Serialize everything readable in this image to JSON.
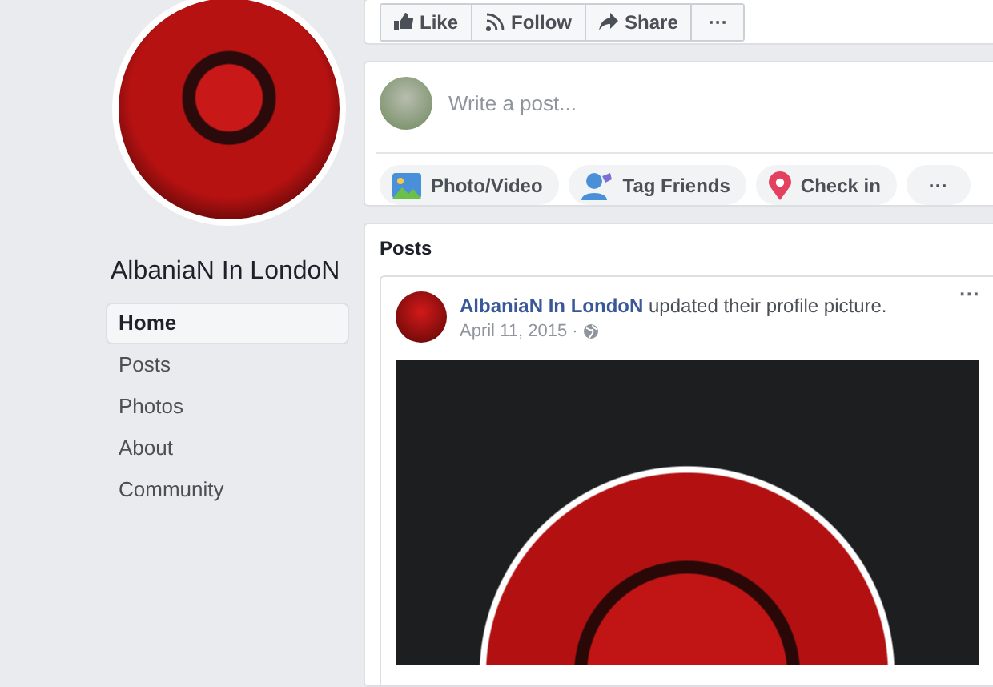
{
  "sidebar": {
    "page_name": "AlbaniaN In LondoN",
    "nav": [
      {
        "label": "Home",
        "selected": true
      },
      {
        "label": "Posts",
        "selected": false
      },
      {
        "label": "Photos",
        "selected": false
      },
      {
        "label": "About",
        "selected": false
      },
      {
        "label": "Community",
        "selected": false
      }
    ]
  },
  "page_actions": [
    {
      "kind": "like",
      "label": "Like"
    },
    {
      "kind": "follow",
      "label": "Follow"
    },
    {
      "kind": "share",
      "label": "Share"
    },
    {
      "kind": "more",
      "label": "···"
    }
  ],
  "composer": {
    "placeholder": "Write a post...",
    "actions": [
      {
        "kind": "photo",
        "label": "Photo/Video"
      },
      {
        "kind": "tag",
        "label": "Tag Friends"
      },
      {
        "kind": "checkin",
        "label": "Check in"
      },
      {
        "kind": "more",
        "label": "···"
      }
    ]
  },
  "posts": {
    "heading": "Posts",
    "post": {
      "author": "AlbaniaN In LondoN",
      "action": "updated their profile picture.",
      "date": "April 11, 2015",
      "separator": "·",
      "menu": "···"
    }
  }
}
